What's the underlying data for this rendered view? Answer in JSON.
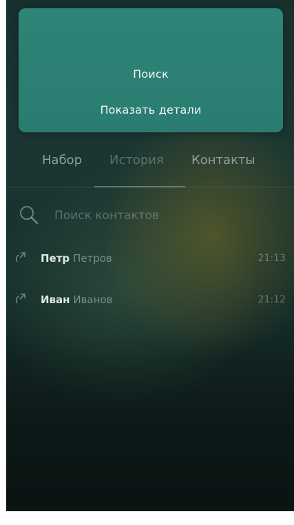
{
  "popup": {
    "search_label": "Поиск",
    "details_label": "Показать детали"
  },
  "tabs": {
    "dial": "Набор",
    "history": "История",
    "contacts": "Контакты",
    "active": "history"
  },
  "search": {
    "placeholder": "Поиск контактов",
    "value": ""
  },
  "calls": [
    {
      "first_name": "Петр",
      "last_name": "Петров",
      "time": "21:13",
      "icon": "outgoing-call-icon"
    },
    {
      "first_name": "Иван",
      "last_name": "Иванов",
      "time": "21:12",
      "icon": "outgoing-call-icon"
    }
  ],
  "colors": {
    "popup_bg": "#2e8478",
    "background_dark": "#16302c"
  }
}
